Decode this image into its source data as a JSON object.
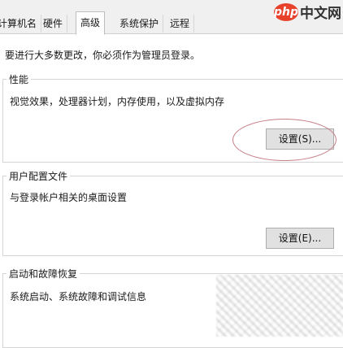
{
  "tabs": [
    {
      "label": "计算机名"
    },
    {
      "label": "硬件"
    },
    {
      "label": "高级"
    },
    {
      "label": "系统保护"
    },
    {
      "label": "远程"
    }
  ],
  "logo": {
    "brand": "php",
    "suffix": "中文网"
  },
  "notice": "要进行大多数更改，你必须作为管理员登录。",
  "performance": {
    "title": "性能",
    "description": "视觉效果，处理器计划，内存使用，以及虚拟内存",
    "button": "设置(S)..."
  },
  "user_profiles": {
    "title": "用户配置文件",
    "description": "与登录帐户相关的桌面设置",
    "button": "设置(E)..."
  },
  "startup_recovery": {
    "title": "启动和故障恢复",
    "description": "系统启动、系统故障和调试信息"
  },
  "colors": {
    "highlight_ellipse": "#c57e86",
    "logo_red": "#e8412c"
  }
}
